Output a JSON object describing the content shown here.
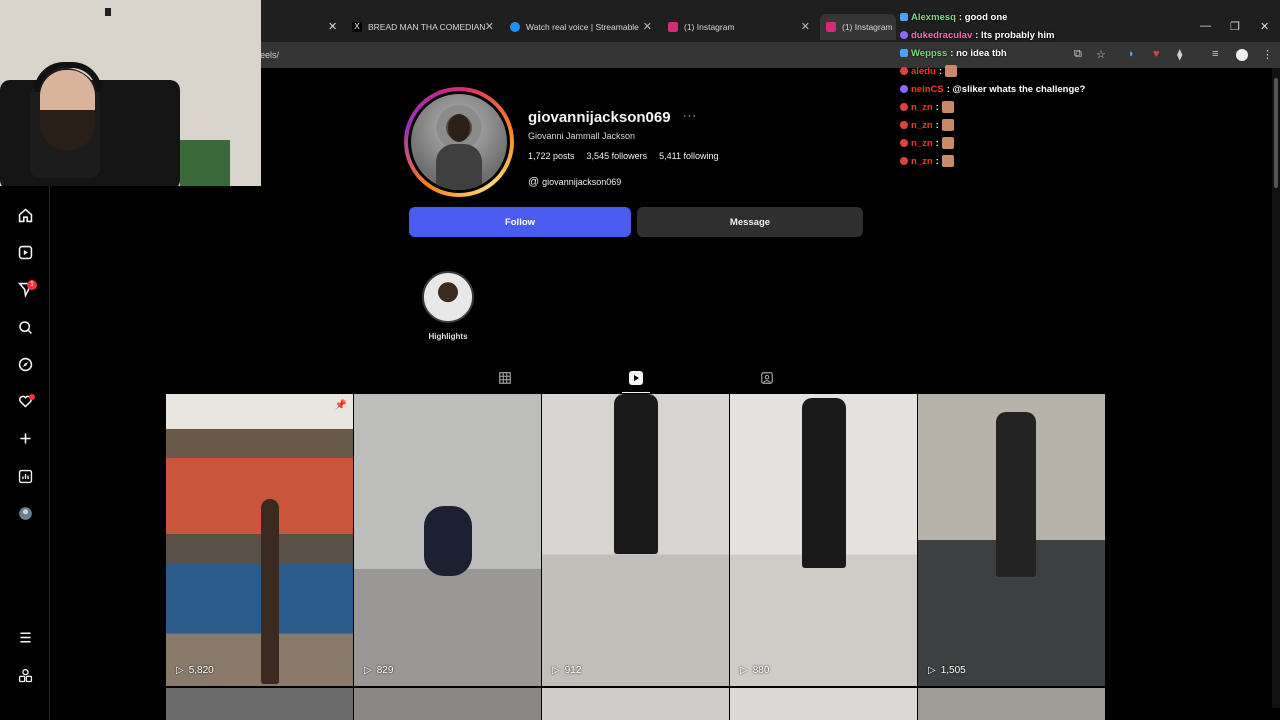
{
  "browser": {
    "tabs": [
      {
        "title": "BREAD MAN THA COMEDIAN",
        "favicon": "x-icon",
        "color": "#000000"
      },
      {
        "title": "Watch real voice | Streamable",
        "favicon": "streamable-icon",
        "color": "#1e90ff"
      },
      {
        "title": "(1) Instagram",
        "favicon": "instagram-icon",
        "color": "#d62976"
      },
      {
        "title": "(1) Instagram",
        "favicon": "instagram-icon",
        "color": "#d62976"
      }
    ],
    "url": "eels/"
  },
  "profile": {
    "username": "giovannijackson069",
    "full_name": "Giovanni Jammall Jackson",
    "posts": "1,722 posts",
    "followers": "3,545 followers",
    "following": "5,411 following",
    "threads_handle": "giovannijackson069",
    "follow_label": "Follow",
    "message_label": "Message",
    "highlight_label": "Highlights"
  },
  "nav": {
    "notification_count": "1"
  },
  "reels": [
    {
      "views": "5,820"
    },
    {
      "views": "829"
    },
    {
      "views": "912"
    },
    {
      "views": "880"
    },
    {
      "views": "1,505"
    }
  ],
  "chat": [
    {
      "user": "Alexmesq",
      "message": ": good one",
      "color": "#7fd67f"
    },
    {
      "user": "dukedraculav",
      "message": ": Its probably him",
      "color": "#ff69b4"
    },
    {
      "user": "Weppss",
      "message": ": no idea tbh",
      "color": "#7fd67f"
    },
    {
      "user": "aledu",
      "message": ":",
      "color": "#ff3030"
    },
    {
      "user": "neinCS",
      "message": ": @sliker whats the challenge?",
      "color": "#ff3030"
    },
    {
      "user": "n_zn",
      "message": ":",
      "color": "#ff3030"
    },
    {
      "user": "n_zn",
      "message": ":",
      "color": "#ff3030"
    },
    {
      "user": "n_zn",
      "message": ":",
      "color": "#ff3030"
    },
    {
      "user": "n_zn",
      "message": ":",
      "color": "#ff3030"
    }
  ]
}
